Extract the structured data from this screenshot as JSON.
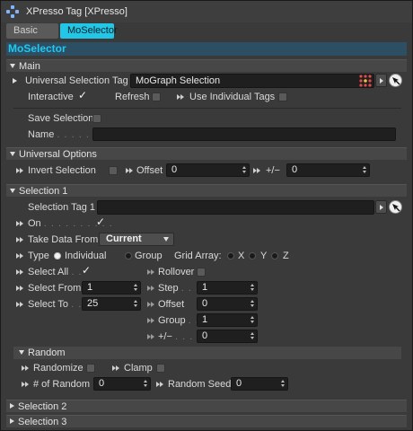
{
  "window": {
    "title": "XPresso Tag [XPresso]"
  },
  "tabs": [
    {
      "label": "Basic"
    },
    {
      "label": "MoSelector"
    }
  ],
  "object_header": "MoSelector",
  "main": {
    "label": "Main",
    "universal_selection_tag_label": "Universal Selection Tag",
    "universal_selection_tag_value": "MoGraph Selection",
    "interactive_label": "Interactive",
    "interactive_checked": true,
    "refresh_label": "Refresh",
    "use_individual_tags_label": "Use Individual Tags",
    "save_selection_label": "Save Selection",
    "name_label": "Name",
    "name_dots": ". . . . . .",
    "name_value": ""
  },
  "universal_options": {
    "label": "Universal Options",
    "invert_selection_label": "Invert Selection",
    "offset_label": "Offset",
    "offset_value": "0",
    "plusminus_label": "+/−",
    "plusminus_value": "0"
  },
  "selection1": {
    "label": "Selection 1",
    "selection_tag_label": "Selection Tag 1",
    "selection_tag_value": "",
    "on_label": "On",
    "on_dots": ". . . . . . . . . .",
    "on_checked": true,
    "take_data_from_label": "Take Data From",
    "take_data_from_value": "Current",
    "type_label": "Type",
    "type_options": [
      "Individual",
      "Group"
    ],
    "type_selected": "Individual",
    "grid_array_label": "Grid Array:",
    "grid_axes": [
      "X",
      "Y",
      "Z"
    ],
    "select_all_label": "Select All",
    "select_all_dots": ". .",
    "select_all_checked": true,
    "rollover_label": "Rollover",
    "select_from_label": "Select From",
    "select_from_value": "1",
    "select_to_label": "Select To",
    "select_to_dots": ". .",
    "select_to_value": "25",
    "step_label": "Step",
    "step_dots": ". . .",
    "step_value": "1",
    "offset_label": "Offset",
    "offset_value": "0",
    "group_label": "Group",
    "group_dots": ". .",
    "group_value": "1",
    "plusminus_label": "+/−",
    "plusminus_dots": ". . . .",
    "plusminus_value": "0"
  },
  "random": {
    "label": "Random",
    "randomize_label": "Randomize",
    "clamp_label": "Clamp",
    "num_random_label": "# of Random",
    "num_random_value": "0",
    "random_seed_label": "Random Seed",
    "random_seed_value": "0"
  },
  "collapsed_sections": [
    {
      "label": "Selection 2"
    },
    {
      "label": "Selection 3"
    }
  ]
}
